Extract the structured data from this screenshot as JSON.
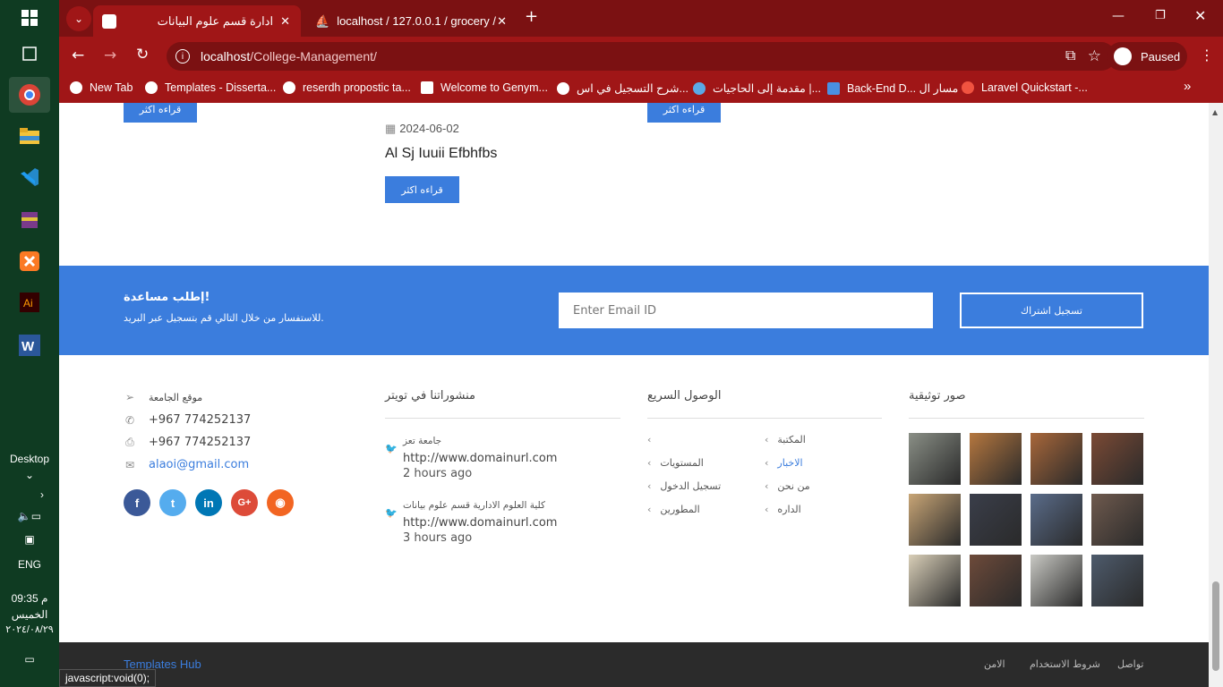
{
  "taskbar": {
    "desktop_label": "Desktop",
    "lang": "ENG",
    "time": "09:35 م",
    "day": "الخميس",
    "date": "٢٠٢٤/٠٨/٢٩"
  },
  "browser": {
    "tabs": [
      {
        "label": "ادارة قسم علوم البيانات",
        "active": true
      },
      {
        "label": "localhost / 127.0.0.1 / grocery /",
        "active": false
      }
    ],
    "url_host": "localhost",
    "url_path": "/College-Management/",
    "profile_label": "Paused",
    "bookmarks": [
      "New Tab",
      "Templates - Disserta...",
      "reserdh propostic ta...",
      "Welcome to Genym...",
      "شرح التسجيل في اس...",
      "مقدمة إلى الحاجيات |...",
      "Back-End D... مسار ال",
      "Laravel Quickstart -..."
    ]
  },
  "news": {
    "read_more": "قراءه اكثر",
    "date": "2024-06-02",
    "title": "Al Sj Iuuii Efbhfbs"
  },
  "subscribe": {
    "title": "إطلب مساعدة!",
    "text": "للاستفسار من خلال التالي قم بتسجيل عبر البريد.",
    "placeholder": "Enter Email ID",
    "button": "تسجيل اشتراك"
  },
  "contact": {
    "location": "موقع الجامعة",
    "phone": "+967 774252137",
    "fax": "+967 774252137",
    "email": "alaoi@gmail.com"
  },
  "twitter": {
    "heading": "منشوراتنا في تويتر",
    "tweets": [
      {
        "author": "جامعة تعز",
        "url": "http://www.domainurl.com",
        "time": "2 hours ago"
      },
      {
        "author": "كلية العلوم الادارية قسم علوم بيانات",
        "url": "http://www.domainurl.com",
        "time": "3 hours ago"
      }
    ]
  },
  "quick_links": {
    "heading": "الوصول السريع",
    "right": [
      "المكتبة",
      "الاخبار",
      "من نحن",
      "الداره"
    ],
    "left": [
      "",
      "المستويات",
      "تسجيل الدخول",
      "المطورين"
    ]
  },
  "gallery": {
    "heading": "صور توثيقية",
    "colors": [
      "#8a8f86",
      "#b5773f",
      "#a8673a",
      "#7b4a35",
      "#c8a576",
      "#3a3e4a",
      "#5a6c8a",
      "#6f5a4e",
      "#d9cfb8",
      "#6d4a3a",
      "#c9c9c4",
      "#4e5b6c"
    ]
  },
  "footer": {
    "brand": "Templates Hub",
    "links": [
      "تواصل",
      "شروط الاستخدام",
      "الامن"
    ]
  },
  "status_text": "javascript:void(0);"
}
